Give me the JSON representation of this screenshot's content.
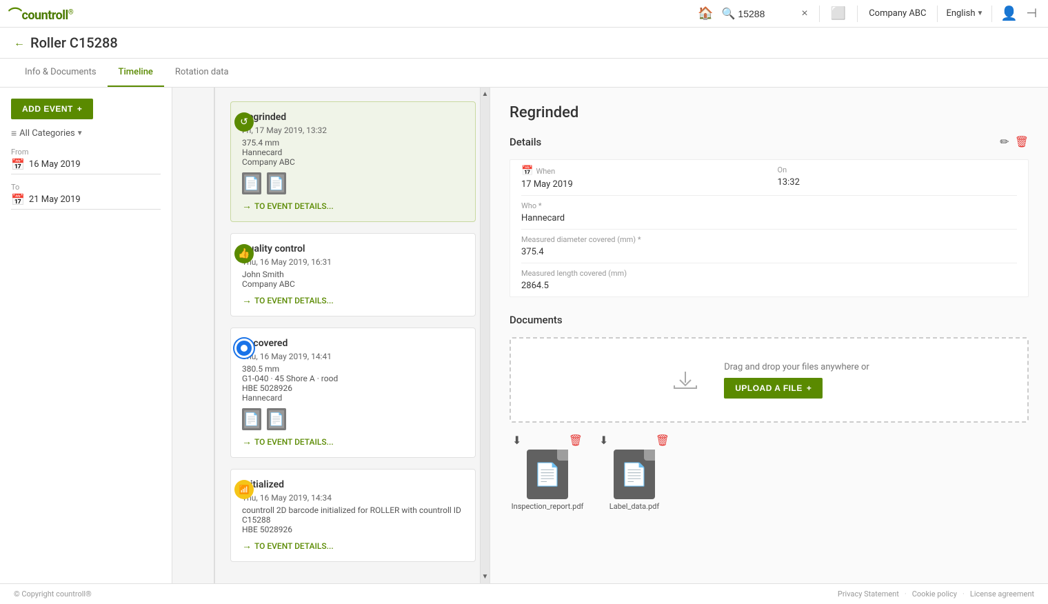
{
  "app": {
    "logo": "countroll",
    "logo_registered": "®"
  },
  "topnav": {
    "search_value": "15288",
    "clear_icon": "×",
    "document_icon": "📋",
    "company": "Company ABC",
    "language": "English",
    "lang_caret": "▼",
    "user_icon": "👤",
    "logout_icon": "⊣"
  },
  "page": {
    "back_label": "←",
    "title": "Roller C15288"
  },
  "tabs": [
    {
      "id": "info",
      "label": "Info & Documents",
      "active": false
    },
    {
      "id": "timeline",
      "label": "Timeline",
      "active": true
    },
    {
      "id": "rotation",
      "label": "Rotation data",
      "active": false
    }
  ],
  "sidebar": {
    "add_event_label": "ADD EVENT",
    "add_icon": "+",
    "filter_icon": "≡",
    "filter_label": "All Categories",
    "filter_caret": "▼",
    "from_label": "From",
    "from_value": "16 May 2019",
    "to_label": "To",
    "to_value": "21 May 2019",
    "calendar_icon": "📅"
  },
  "timeline": {
    "events": [
      {
        "id": "regrinded",
        "title": "Regrinded",
        "date": "Fri, 17 May 2019, 13:32",
        "detail1": "375.4 mm",
        "detail2": "Hannecard",
        "detail3": "Company ABC",
        "has_docs": true,
        "doc_count": 2,
        "link_label": "TO EVENT DETAILS...",
        "active": true,
        "marker_type": "green",
        "marker_icon": "↺"
      },
      {
        "id": "quality",
        "title": "Quality control",
        "date": "Thu, 16 May 2019, 16:31",
        "detail1": "",
        "detail2": "John Smith",
        "detail3": "Company ABC",
        "has_docs": false,
        "doc_count": 0,
        "link_label": "TO EVENT DETAILS...",
        "active": false,
        "marker_type": "thumbs",
        "marker_icon": "👍"
      },
      {
        "id": "recovered",
        "title": "Recovered",
        "date": "Thu, 16 May 2019, 14:41",
        "detail1": "380.5 mm",
        "detail2": "G1-040 · 45 Shore A · rood",
        "detail3": "HBE 5028926",
        "detail4": "Hannecard",
        "has_docs": true,
        "doc_count": 2,
        "link_label": "TO EVENT DETAILS...",
        "active": false,
        "marker_type": "blue",
        "marker_icon": "○"
      },
      {
        "id": "initialized",
        "title": "Initialized",
        "date": "Thu, 16 May 2019, 14:34",
        "detail1": "countroll 2D barcode initialized for ROLLER with countroll ID C15288",
        "detail2": "HBE 5028926",
        "has_docs": false,
        "doc_count": 0,
        "link_label": "TO EVENT DETAILS...",
        "active": false,
        "marker_type": "yellow",
        "marker_icon": "📶"
      }
    ]
  },
  "detail_panel": {
    "title": "Regrinded",
    "section_details": "Details",
    "edit_icon": "✏",
    "delete_icon": "🗑",
    "when_label": "When",
    "when_value": "17 May 2019",
    "on_label": "On",
    "on_value": "13:32",
    "who_label": "Who *",
    "who_value": "Hannecard",
    "measured_diameter_label": "Measured diameter covered (mm) *",
    "measured_diameter_value": "375.4",
    "measured_length_label": "Measured length covered (mm)",
    "measured_length_value": "2864.5",
    "section_documents": "Documents",
    "drag_drop_text": "Drag and drop your files anywhere or",
    "upload_btn_label": "UPLOAD A FILE",
    "upload_icon": "+",
    "download_icon": "⬇",
    "documents": [
      {
        "id": "doc1",
        "filename": "Inspection_report.pdf"
      },
      {
        "id": "doc2",
        "filename": "Label_data.pdf"
      }
    ]
  },
  "footer": {
    "copyright": "© Copyright countroll®",
    "links": [
      {
        "id": "privacy",
        "label": "Privacy Statement"
      },
      {
        "id": "cookie",
        "label": "Cookie policy"
      },
      {
        "id": "license",
        "label": "License agreement"
      }
    ],
    "separator": "·"
  }
}
